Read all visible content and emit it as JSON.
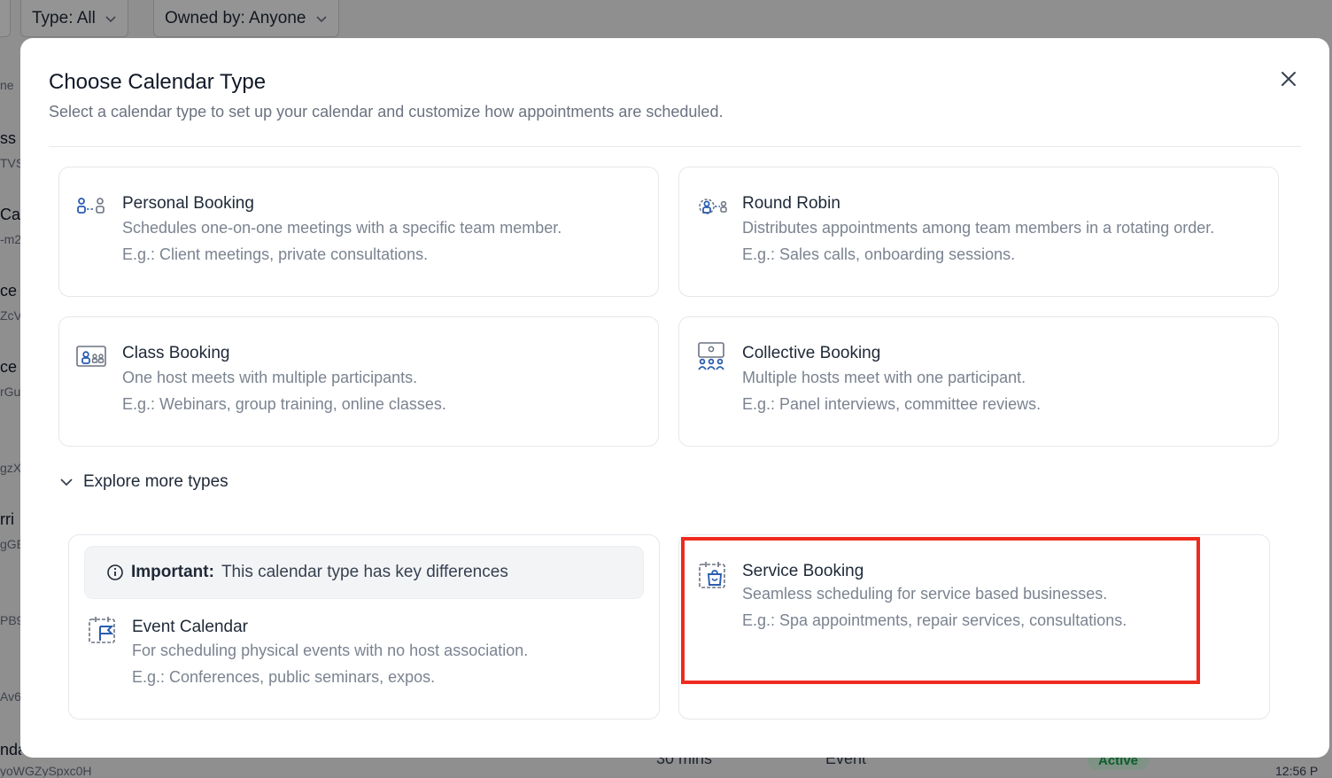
{
  "background": {
    "filters": [
      {
        "label": "Type: All"
      },
      {
        "label": "Owned by: Anyone"
      }
    ],
    "left_fragments": [
      "ne",
      "ss B",
      "TVS",
      " Ca",
      "-m2",
      "ce",
      "ZcV",
      "ce",
      "rGu",
      "gzX",
      "rri",
      "gGE",
      "PB9",
      "Av6",
      "nda"
    ],
    "bottom_duration": "30 mins",
    "bottom_type": "Event",
    "bottom_status": "Active",
    "bottom_id": "yoWGZySpxc0H",
    "bottom_time": "12:56 P"
  },
  "modal": {
    "title": "Choose Calendar Type",
    "subtitle": "Select a calendar type to set up your calendar and customize how appointments are scheduled.",
    "cards": [
      {
        "title": "Personal Booking",
        "desc": "Schedules one-on-one meetings with a specific team member.",
        "example": "E.g.: Client meetings, private consultations.",
        "icon": "personal-booking-icon"
      },
      {
        "title": "Round Robin",
        "desc": "Distributes appointments among team members in a rotating order.",
        "example": "E.g.: Sales calls, onboarding sessions.",
        "icon": "round-robin-icon"
      },
      {
        "title": "Class Booking",
        "desc": "One host meets with multiple participants.",
        "example": "E.g.: Webinars, group training, online classes.",
        "icon": "class-booking-icon"
      },
      {
        "title": "Collective Booking",
        "desc": "Multiple hosts meet with one participant.",
        "example": "E.g.: Panel interviews, committee reviews.",
        "icon": "collective-booking-icon"
      }
    ],
    "explore_label": "Explore more types",
    "important_label": "Important:",
    "important_text": "This calendar type has key differences",
    "event_card": {
      "title": "Event Calendar",
      "desc": "For scheduling physical events with no host association.",
      "example": "E.g.: Conferences, public seminars, expos.",
      "icon": "event-calendar-icon"
    },
    "service_card": {
      "title": "Service Booking",
      "desc": "Seamless scheduling for service based businesses.",
      "example": "E.g.: Spa appointments, repair services, consultations.",
      "icon": "service-booking-icon"
    }
  },
  "colors": {
    "accent_icon": "#2a5db0",
    "highlight": "#ee2b1f"
  }
}
